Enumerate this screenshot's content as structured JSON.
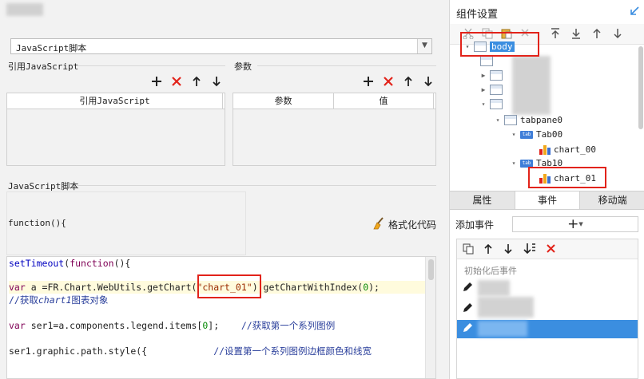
{
  "left": {
    "script_select_value": "JavaScript脚本",
    "ref_section_title": "引用JavaScript",
    "params_section_title": "参数",
    "ref_table_header": "引用JavaScript",
    "params_header_param": "参数",
    "params_header_value": "值",
    "script_section_title": "JavaScript脚本",
    "function_label": "function(){",
    "format_button_label": "格式化代码",
    "code_lines": [
      "setTimeout(function(){",
      "var a =FR.Chart.WebUtils.getChart(\"chart_01\").getChartWithIndex(0);",
      "//获取chart1图表对象",
      "var ser1=a.components.legend.items[0];",
      "//获取第一个系列图例",
      "ser1.graphic.path.style({",
      "//设置第一个系列图例边框颜色和线宽"
    ],
    "code_tokens": {
      "line1_kw1": "setTimeout",
      "line1_paren": "(",
      "line1_kw2": "function",
      "line1_rest": "(){",
      "line2_kw": "var",
      "line2_a": " a =FR.Chart.WebUtils.",
      "line2_fn": "getChart",
      "line2_open": "(",
      "line2_str": "\"chart_01\"",
      "line2_close": ").",
      "line2_fn2": "getChartWithIndex",
      "line2_open2": "(",
      "line2_num": "0",
      "line2_end": ");",
      "line3_cm": "//获取",
      "line3_cm_it": "chart1",
      "line3_cm2": "图表对象",
      "line4_kw": "var",
      "line4_rest": " ser1=a.components.legend.items[",
      "line4_num": "0",
      "line4_end": "];",
      "line4_cm": "//获取第一个系列图例",
      "line5_a": "ser1.graphic.path.",
      "line5_fn": "style",
      "line5_end": "({",
      "line5_cm": "//设置第一个系列图例边框颜色和线宽"
    }
  },
  "right": {
    "title": "组件设置",
    "tree": {
      "body": "body",
      "tabpane": "tabpane0",
      "tab0": "Tab00",
      "chart0": "chart_00",
      "tab1": "Tab10",
      "chart1": "chart_01",
      "tab_icon_text": "tab"
    },
    "tabs": [
      "属性",
      "事件",
      "移动端"
    ],
    "active_tab": "事件",
    "add_event_label": "添加事件",
    "add_event_button": "+",
    "events_group_label": "初始化后事件"
  },
  "colors": {
    "accent": "#3b8ee0",
    "highlight_box": "#e2231a",
    "delete_icon": "#e2231a"
  }
}
